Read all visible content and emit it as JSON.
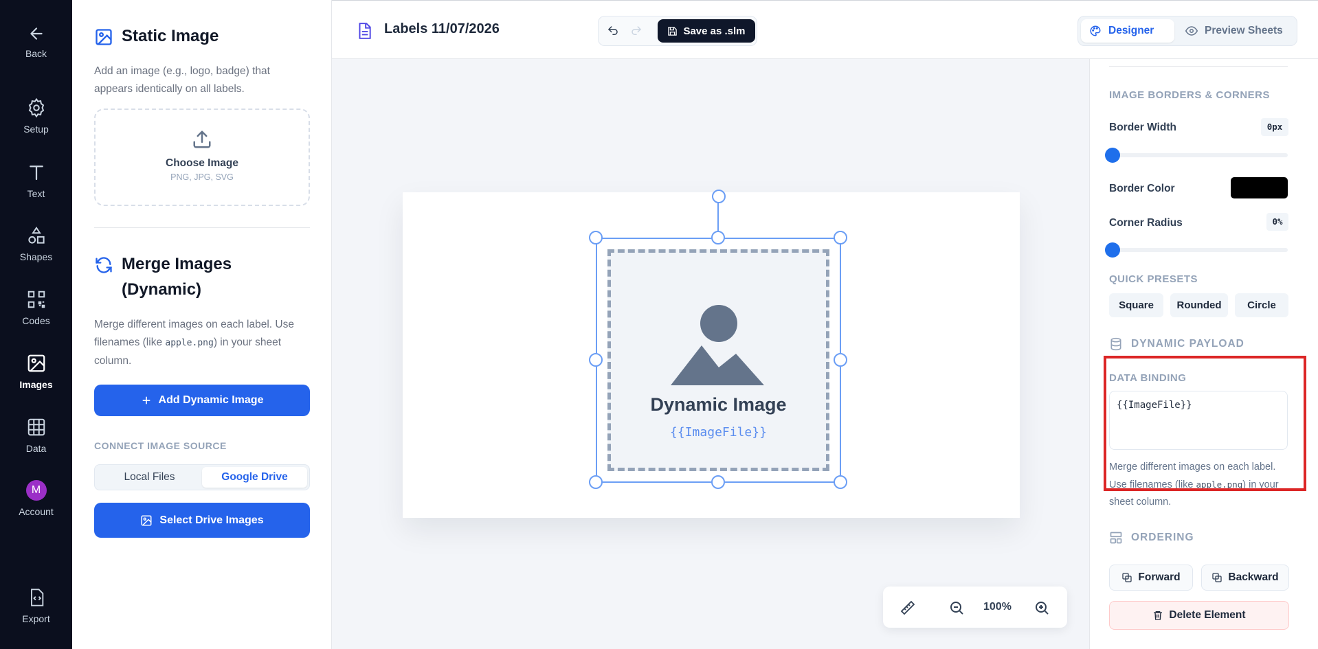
{
  "rail": {
    "back": "Back",
    "items": [
      "Setup",
      "Text",
      "Shapes",
      "Codes",
      "Images",
      "Data",
      "Account"
    ],
    "account_initial": "M",
    "export": "Export"
  },
  "static_image": {
    "title": "Static Image",
    "description": "Add an image (e.g., logo, badge) that appears identically on all labels.",
    "choose_label": "Choose Image",
    "formats": "PNG, JPG, SVG"
  },
  "merge_images": {
    "title_line1": "Merge Images",
    "title_line2": "(Dynamic)",
    "desc_before": "Merge different images on each label. Use filenames (like ",
    "desc_code": "apple.png",
    "desc_after": ") in your sheet column.",
    "add_button": "Add Dynamic Image",
    "connect_label": "CONNECT IMAGE SOURCE",
    "sources": [
      "Local Files",
      "Google Drive"
    ],
    "active_source": "Google Drive",
    "select_button": "Select Drive Images"
  },
  "topbar": {
    "doc_title": "Labels 11/07/2026",
    "save_button": "Save as .slm",
    "mode_designer": "Designer",
    "mode_preview": "Preview Sheets"
  },
  "canvas": {
    "placeholder_title": "Dynamic Image",
    "placeholder_binding": "{{ImageFile}}",
    "zoom": "100%"
  },
  "properties": {
    "borders_header": "IMAGE BORDERS & CORNERS",
    "border_width_label": "Border Width",
    "border_width_value": "0px",
    "border_color_label": "Border Color",
    "border_color": "#000000",
    "corner_radius_label": "Corner Radius",
    "corner_radius_value": "0%",
    "quick_presets_label": "QUICK PRESETS",
    "presets": [
      "Square",
      "Rounded",
      "Circle"
    ],
    "dynamic_header": "DYNAMIC PAYLOAD",
    "data_binding_label": "DATA BINDING",
    "data_binding_value": "{{ImageFile}}",
    "binding_help_before": "Merge different images on each label. Use filenames (like ",
    "binding_help_code": "apple.png",
    "binding_help_after": ") in your sheet column.",
    "ordering_header": "ORDERING",
    "forward": "Forward",
    "backward": "Backward",
    "delete": "Delete Element"
  },
  "colors": {
    "accent": "#2563eb",
    "rail_bg": "#0b0f1e",
    "highlight": "#dc2626"
  }
}
